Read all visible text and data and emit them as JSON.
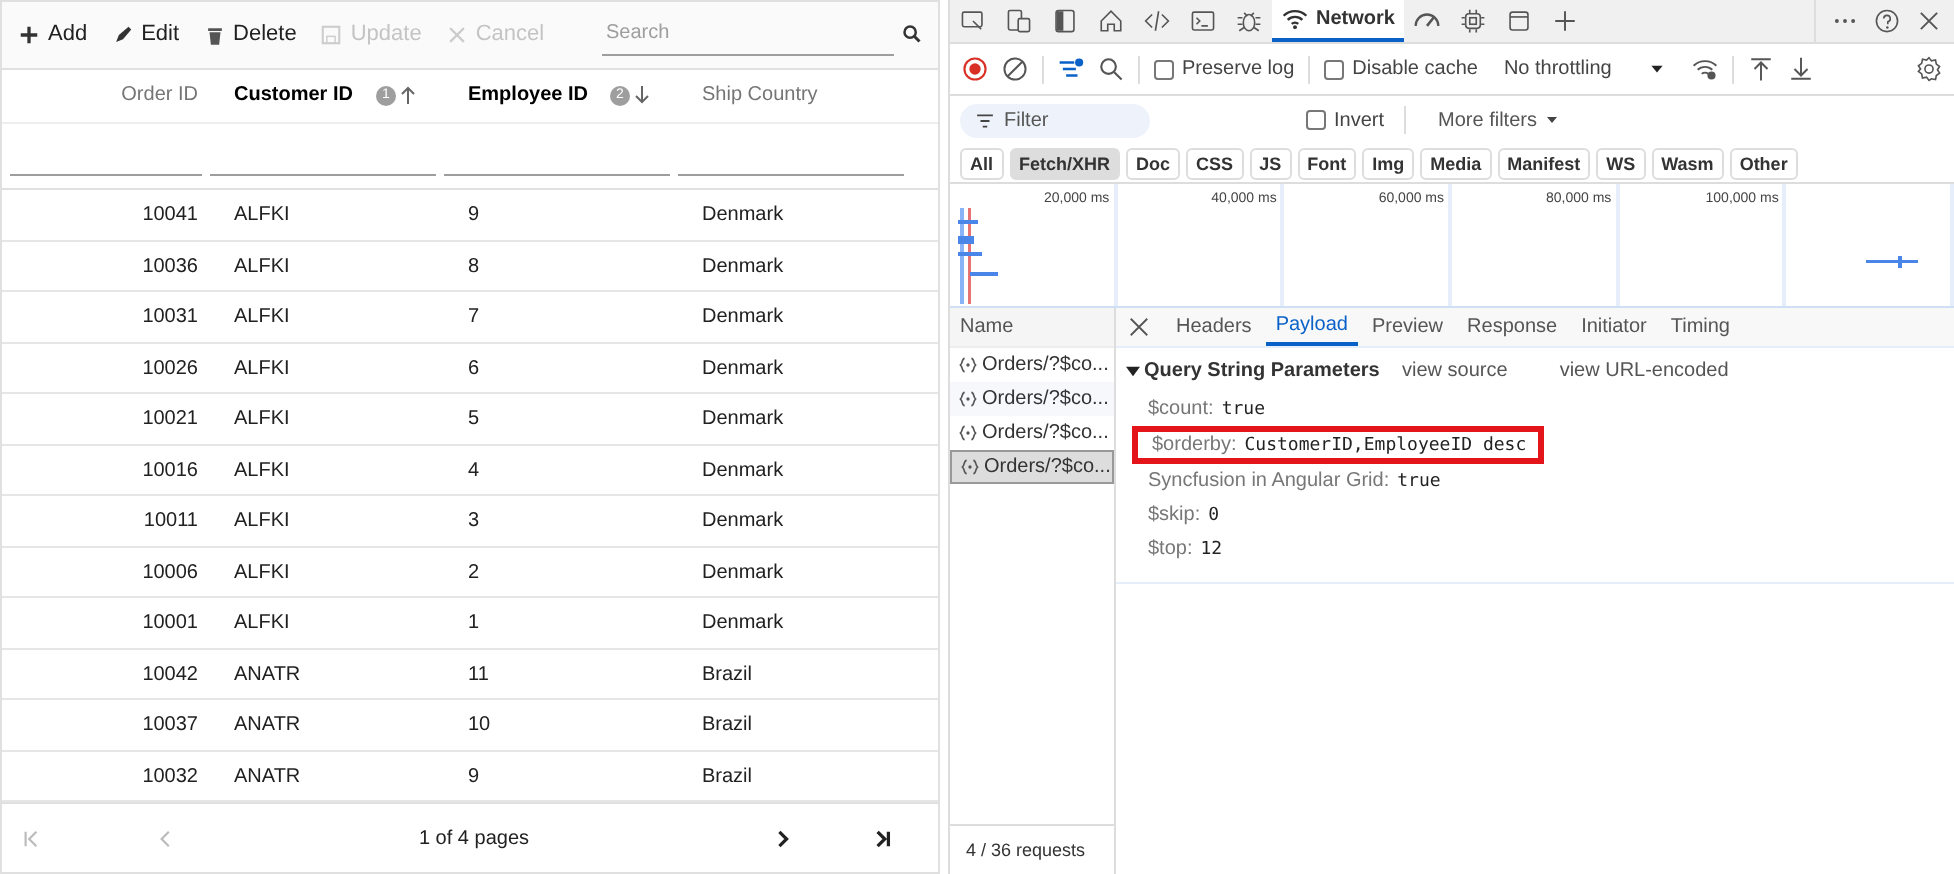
{
  "grid": {
    "toolbar": [
      {
        "kind": "add",
        "label": "Add",
        "disabled": false
      },
      {
        "kind": "edit",
        "label": "Edit",
        "disabled": false
      },
      {
        "kind": "delete",
        "label": "Delete",
        "disabled": false
      },
      {
        "kind": "update",
        "label": "Update",
        "disabled": true
      },
      {
        "kind": "cancel",
        "label": "Cancel",
        "disabled": true
      }
    ],
    "search": {
      "placeholder": "Search"
    },
    "columns": [
      {
        "label": "Order ID",
        "sorted": false
      },
      {
        "label": "Customer ID",
        "sorted": true,
        "sort_order": "1",
        "descending": false
      },
      {
        "label": "Employee ID",
        "sorted": true,
        "sort_order": "2",
        "descending": true
      },
      {
        "label": "Ship Country",
        "sorted": false
      }
    ],
    "rows": [
      [
        "10041",
        "ALFKI",
        "9",
        "Denmark"
      ],
      [
        "10036",
        "ALFKI",
        "8",
        "Denmark"
      ],
      [
        "10031",
        "ALFKI",
        "7",
        "Denmark"
      ],
      [
        "10026",
        "ALFKI",
        "6",
        "Denmark"
      ],
      [
        "10021",
        "ALFKI",
        "5",
        "Denmark"
      ],
      [
        "10016",
        "ALFKI",
        "4",
        "Denmark"
      ],
      [
        "10011",
        "ALFKI",
        "3",
        "Denmark"
      ],
      [
        "10006",
        "ALFKI",
        "2",
        "Denmark"
      ],
      [
        "10001",
        "ALFKI",
        "1",
        "Denmark"
      ],
      [
        "10042",
        "ANATR",
        "11",
        "Brazil"
      ],
      [
        "10037",
        "ANATR",
        "10",
        "Brazil"
      ],
      [
        "10032",
        "ANATR",
        "9",
        "Brazil"
      ]
    ],
    "pager": {
      "info": "1 of 4 pages",
      "first_disabled": true,
      "prev_disabled": true,
      "next_disabled": false,
      "last_disabled": false
    }
  },
  "devtools": {
    "tabs": [
      {
        "kind": "inspect",
        "selected": false
      },
      {
        "kind": "device",
        "selected": false
      },
      {
        "kind": "dock",
        "selected": false
      },
      {
        "kind": "home",
        "selected": false
      },
      {
        "kind": "elements",
        "selected": false
      },
      {
        "kind": "console",
        "selected": false
      },
      {
        "kind": "bug",
        "selected": false
      },
      {
        "kind": "network",
        "label": "Network",
        "selected": true
      },
      {
        "kind": "performance",
        "selected": false
      },
      {
        "kind": "memory",
        "selected": false
      },
      {
        "kind": "application",
        "selected": false
      },
      {
        "kind": "add",
        "selected": false
      }
    ],
    "preserve_log": {
      "label": "Preserve log",
      "checked": false
    },
    "disable_cache": {
      "label": "Disable cache",
      "checked": false
    },
    "throttling": "No throttling",
    "filter": {
      "placeholder": "Filter"
    },
    "invert": {
      "label": "Invert",
      "checked": false
    },
    "more_filters": "More filters",
    "types": [
      {
        "label": "All",
        "selected": false
      },
      {
        "label": "Fetch/XHR",
        "selected": true
      },
      {
        "label": "Doc",
        "selected": false
      },
      {
        "label": "CSS",
        "selected": false
      },
      {
        "label": "JS",
        "selected": false
      },
      {
        "label": "Font",
        "selected": false
      },
      {
        "label": "Img",
        "selected": false
      },
      {
        "label": "Media",
        "selected": false
      },
      {
        "label": "Manifest",
        "selected": false
      },
      {
        "label": "WS",
        "selected": false
      },
      {
        "label": "Wasm",
        "selected": false
      },
      {
        "label": "Other",
        "selected": false
      }
    ],
    "timeline_ticks": [
      "20,000 ms",
      "40,000 ms",
      "60,000 ms",
      "80,000 ms",
      "100,000 ms"
    ],
    "name_header": "Name",
    "requests": [
      {
        "name": "Orders/?$co...",
        "selected": false
      },
      {
        "name": "Orders/?$co...",
        "selected": false
      },
      {
        "name": "Orders/?$co...",
        "selected": false
      },
      {
        "name": "Orders/?$co...",
        "selected": true
      }
    ],
    "detail_tabs": [
      {
        "label": "Headers",
        "selected": false
      },
      {
        "label": "Payload",
        "selected": true
      },
      {
        "label": "Preview",
        "selected": false
      },
      {
        "label": "Response",
        "selected": false
      },
      {
        "label": "Initiator",
        "selected": false
      },
      {
        "label": "Timing",
        "selected": false
      }
    ],
    "section": {
      "title": "Query String Parameters",
      "expanded": true,
      "view_source": "view source",
      "view_encoded": "view URL-encoded"
    },
    "params": [
      {
        "key": "$count:",
        "value": "true",
        "highlighted": false
      },
      {
        "key": "$orderby:",
        "value": "CustomerID,EmployeeID desc",
        "highlighted": true
      },
      {
        "key": "Syncfusion in Angular Grid:",
        "value": "true",
        "highlighted": false
      },
      {
        "key": "$skip:",
        "value": "0",
        "highlighted": false
      },
      {
        "key": "$top:",
        "value": "12",
        "highlighted": false
      }
    ],
    "status": "4 / 36 requests"
  }
}
